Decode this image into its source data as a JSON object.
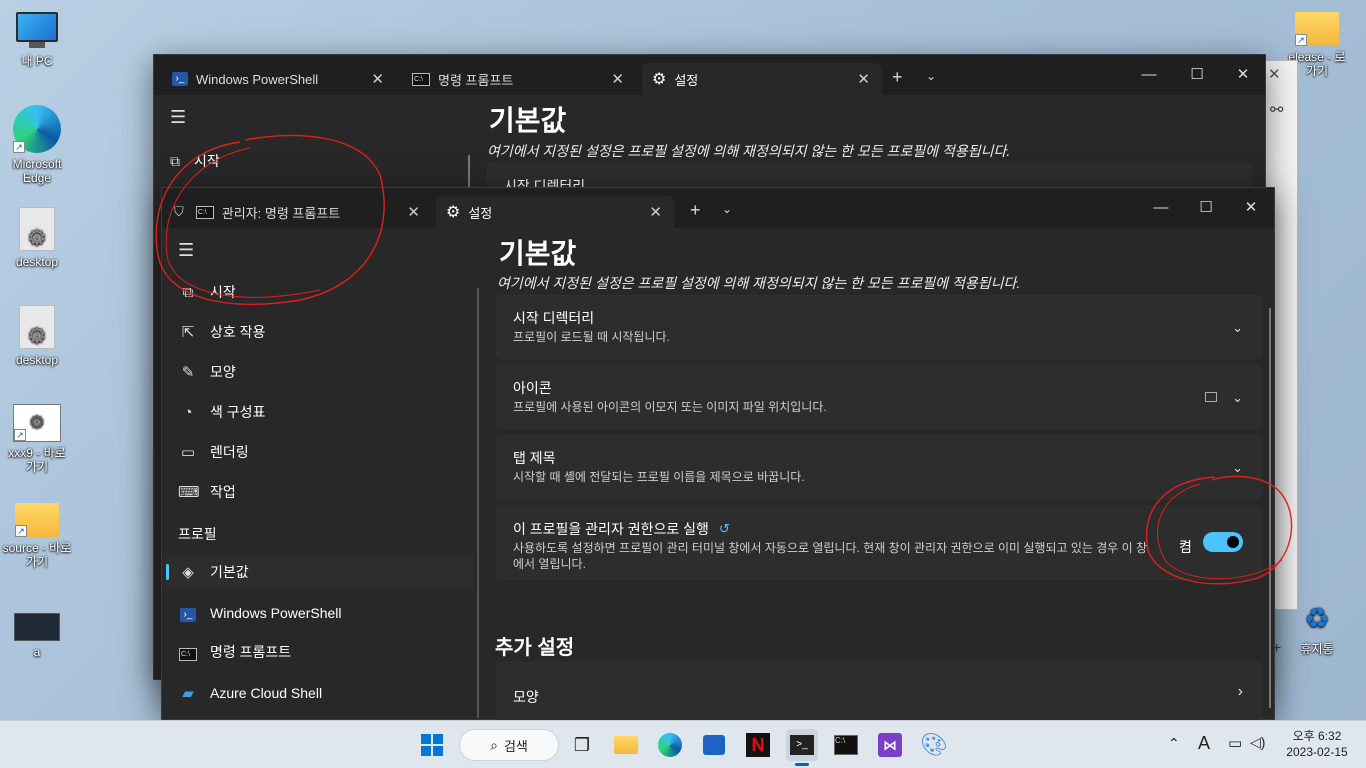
{
  "desktop": {
    "icons": [
      {
        "label": "내 PC"
      },
      {
        "label": "Microsoft Edge"
      },
      {
        "label": "desktop"
      },
      {
        "label": "desktop"
      },
      {
        "label": "xxx9 - 바로 가기"
      },
      {
        "label": "source - 바로 가기"
      },
      {
        "label": "a"
      },
      {
        "label": "elease - 로 가기"
      },
      {
        "label": "휴지통"
      }
    ]
  },
  "back_window": {
    "tabs": [
      {
        "label": "Windows PowerShell",
        "icon": "powershell-icon"
      },
      {
        "label": "명령 프롬프트",
        "icon": "cmd-icon"
      },
      {
        "label": "설정",
        "icon": "gear-icon"
      }
    ],
    "nav": {
      "start": "시작"
    },
    "heading": "기본값",
    "description": "여기에서 지정된 설정은 프로필 설정에 의해 재정의되지 않는 한 모든 프로필에 적용됩니다.",
    "card_title": "시작 디렉터리"
  },
  "front_window": {
    "tabs": [
      {
        "label": "관리자: 명령 프롬프트",
        "icon": "cmd-icon"
      },
      {
        "label": "설정",
        "icon": "gear-icon"
      }
    ],
    "nav": {
      "items": [
        {
          "label": "시작",
          "icon": "start-icon"
        },
        {
          "label": "상호 작용",
          "icon": "interaction-icon"
        },
        {
          "label": "모양",
          "icon": "brush-icon"
        },
        {
          "label": "색 구성표",
          "icon": "palette-icon"
        },
        {
          "label": "렌더링",
          "icon": "monitor-icon"
        },
        {
          "label": "작업",
          "icon": "keyboard-icon"
        }
      ],
      "section_header": "프로필",
      "profiles": [
        {
          "label": "기본값",
          "icon": "layers-icon",
          "selected": true
        },
        {
          "label": "Windows PowerShell",
          "icon": "powershell-icon"
        },
        {
          "label": "명령 프롬프트",
          "icon": "cmd-icon"
        },
        {
          "label": "Azure Cloud Shell",
          "icon": "azure-icon"
        }
      ]
    },
    "heading": "기본값",
    "description": "여기에서 지정된 설정은 프로필 설정에 의해 재정의되지 않는 한 모든 프로필에 적용됩니다.",
    "cards": [
      {
        "title": "시작 디렉터리",
        "subtitle": "프로필이 로드될 때 시작됩니다."
      },
      {
        "title": "아이콘",
        "subtitle": "프로필에 사용된 아이콘의 이모지 또는 이미지 파일 위치입니다."
      },
      {
        "title": "탭 제목",
        "subtitle": "시작할 때 셸에 전달되는 프로필 이름을 제목으로 바꿉니다."
      },
      {
        "title": "이 프로필을 관리자 권한으로 실행",
        "subtitle": "사용하도록 설정하면 프로필이 관리 터미널 창에서 자동으로 열립니다. 현재 창이 관리자 권한으로 이미 실행되고 있는 경우 이 창에서 열립니다.",
        "toggle_state": "켬",
        "toggle_on": true
      }
    ],
    "section2": "추가 설정",
    "card_appearance": "모양"
  },
  "taskbar": {
    "search_label": "검색",
    "time": "오후 6:32",
    "date": "2023-02-15",
    "ime": "A"
  },
  "colors": {
    "accent": "#4cc2ff",
    "annotation": "#e0201c"
  }
}
